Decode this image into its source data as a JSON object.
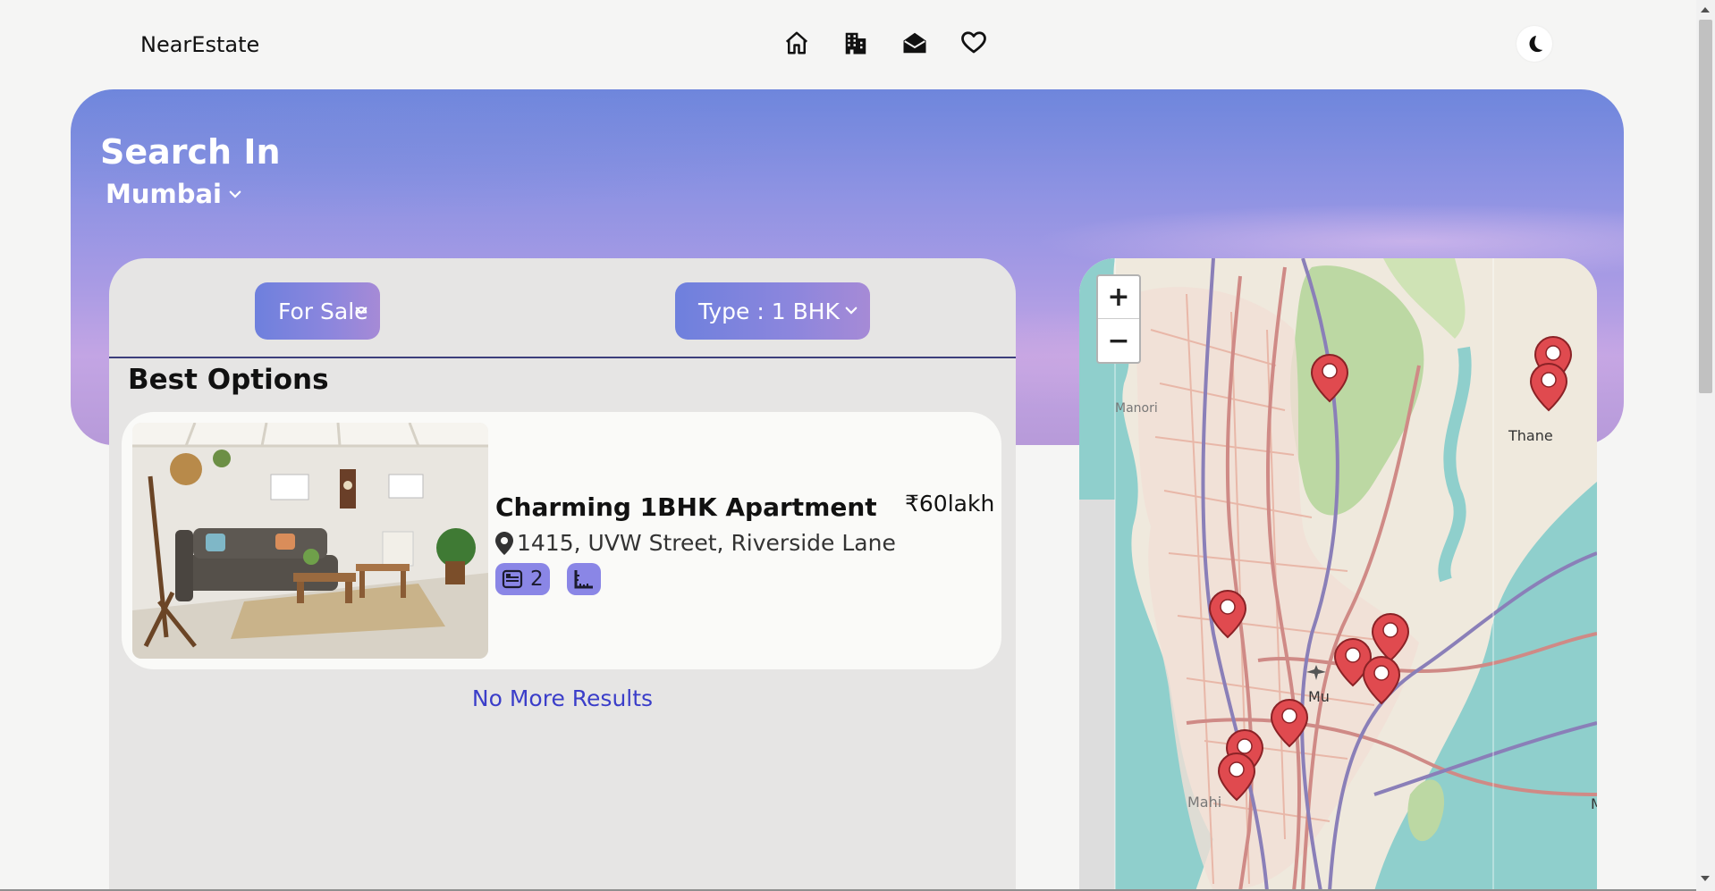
{
  "header": {
    "brand": "NearEstate",
    "nav_icons": [
      "home-icon",
      "building-icon",
      "envelope-open-icon",
      "heart-icon"
    ],
    "theme_icon": "moon-icon"
  },
  "hero": {
    "title": "Search In",
    "city": "Mumbai"
  },
  "filters": {
    "listing": "For Sale",
    "type": "Type : 1 BHK"
  },
  "results": {
    "heading": "Best Options",
    "listings": [
      {
        "title": "Charming 1BHK Apartment",
        "price": "₹60lakh",
        "address": "1415, UVW Street, Riverside Lane",
        "bathrooms": "2",
        "icons": [
          "location-pin-icon",
          "bathtub-icon",
          "area-ruler-icon"
        ]
      }
    ],
    "footer": "No More Results"
  },
  "map": {
    "zoom_in": "+",
    "zoom_out": "−",
    "labels": [
      "Manori",
      "Thane",
      "Mu",
      "Mahi",
      "M"
    ]
  },
  "colors": {
    "accent": "#6e80dd",
    "badge": "#8a86e6",
    "link": "#3b3ec9",
    "divider": "#3c3f7c",
    "marker": "#e04a4f"
  }
}
